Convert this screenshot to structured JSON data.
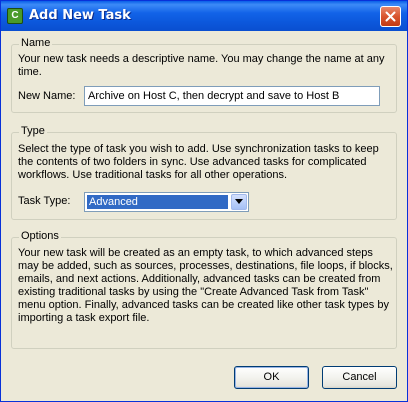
{
  "window": {
    "title": "Add New Task",
    "app_icon_glyph": "C"
  },
  "name_group": {
    "legend": "Name",
    "description": "Your new task needs a descriptive name.  You may change the name at any time.",
    "field_label": "New Name:",
    "field_value": "Archive on Host C, then decrypt and save to Host B"
  },
  "type_group": {
    "legend": "Type",
    "description": "Select the type of task you wish to add. Use synchronization tasks to keep the contents of two folders in sync. Use advanced tasks for complicated workflows. Use traditional tasks for all other operations.",
    "field_label": "Task Type:",
    "selected": "Advanced"
  },
  "options_group": {
    "legend": "Options",
    "description": "Your new task will be created as an empty task, to which advanced steps may be added, such as sources, processes, destinations, file loops, if blocks, emails, and next actions. Additionally, advanced tasks can be created from existing traditional tasks by using the \"Create Advanced Task from Task\" menu option. Finally, advanced tasks can be created like other task types by importing a task export file."
  },
  "buttons": {
    "ok": "OK",
    "cancel": "Cancel"
  },
  "colors": {
    "titlebar": "#0a5fe8",
    "dialog_bg": "#ece9d8",
    "selection": "#316ac5"
  },
  "icons": {
    "app": "app-icon",
    "close": "close-icon",
    "dropdown": "chevron-down-icon"
  }
}
